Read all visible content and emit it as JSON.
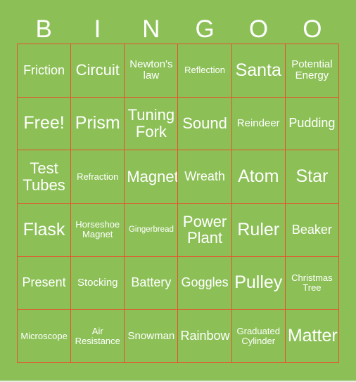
{
  "card": {
    "background_color": "#8cc057",
    "grid_line_color": "#e8502a",
    "text_color": "#ffffff",
    "columns": 6,
    "rows": 6,
    "header": {
      "letters": [
        "B",
        "I",
        "N",
        "G",
        "O",
        "O"
      ]
    },
    "cells": [
      [
        {
          "label": "Friction",
          "size": "md"
        },
        {
          "label": "Circuit",
          "size": "lg"
        },
        {
          "label": "Newton's law",
          "size": "sm"
        },
        {
          "label": "Reflection",
          "size": "xs"
        },
        {
          "label": "Santa",
          "size": "xl"
        },
        {
          "label": "Potential Energy",
          "size": "sm"
        }
      ],
      [
        {
          "label": "Free!",
          "size": "xl"
        },
        {
          "label": "Prism",
          "size": "xl"
        },
        {
          "label": "Tuning Fork",
          "size": "lg"
        },
        {
          "label": "Sound",
          "size": "lg"
        },
        {
          "label": "Reindeer",
          "size": "sm"
        },
        {
          "label": "Pudding",
          "size": "md"
        }
      ],
      [
        {
          "label": "Test Tubes",
          "size": "lg"
        },
        {
          "label": "Refraction",
          "size": "xs"
        },
        {
          "label": "Magnet",
          "size": "lg"
        },
        {
          "label": "Wreath",
          "size": "md"
        },
        {
          "label": "Atom",
          "size": "xl"
        },
        {
          "label": "Star",
          "size": "xl"
        }
      ],
      [
        {
          "label": "Flask",
          "size": "xl"
        },
        {
          "label": "Horseshoe Magnet",
          "size": "xs"
        },
        {
          "label": "Gingerbread",
          "size": "xxs"
        },
        {
          "label": "Power Plant",
          "size": "lg"
        },
        {
          "label": "Ruler",
          "size": "xl"
        },
        {
          "label": "Beaker",
          "size": "md"
        }
      ],
      [
        {
          "label": "Present",
          "size": "md"
        },
        {
          "label": "Stocking",
          "size": "sm"
        },
        {
          "label": "Battery",
          "size": "md"
        },
        {
          "label": "Goggles",
          "size": "md"
        },
        {
          "label": "Pulley",
          "size": "xl"
        },
        {
          "label": "Christmas Tree",
          "size": "xs"
        }
      ],
      [
        {
          "label": "Microscope",
          "size": "xs"
        },
        {
          "label": "Air Resistance",
          "size": "xs"
        },
        {
          "label": "Snowman",
          "size": "sm"
        },
        {
          "label": "Rainbow",
          "size": "md"
        },
        {
          "label": "Graduated Cylinder",
          "size": "xs"
        },
        {
          "label": "Matter",
          "size": "xl"
        }
      ]
    ]
  }
}
